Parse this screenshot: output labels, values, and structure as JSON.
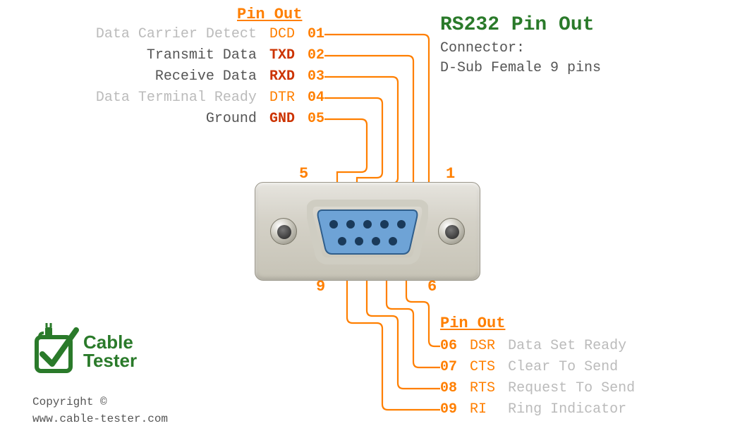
{
  "title": "RS232 Pin Out",
  "subtitle_label": "Connector:",
  "subtitle_value": "D-Sub Female 9 pins",
  "top_header": "Pin Out",
  "bot_header": "Pin Out",
  "top_pins": [
    {
      "desc": "Data Carrier Detect",
      "sig": "DCD",
      "num": "01",
      "emph": false
    },
    {
      "desc": "Transmit Data",
      "sig": "TXD",
      "num": "02",
      "emph": true
    },
    {
      "desc": "Receive  Data",
      "sig": "RXD",
      "num": "03",
      "emph": true
    },
    {
      "desc": "Data Terminal Ready",
      "sig": "DTR",
      "num": "04",
      "emph": false
    },
    {
      "desc": "Ground",
      "sig": "GND",
      "num": "05",
      "emph": true
    }
  ],
  "bot_pins": [
    {
      "num": "06",
      "sig": "DSR",
      "desc": "Data Set Ready"
    },
    {
      "num": "07",
      "sig": "CTS",
      "desc": "Clear To Send"
    },
    {
      "num": "08",
      "sig": "RTS",
      "desc": "Request To Send"
    },
    {
      "num": "09",
      "sig": "RI",
      "desc": "Ring Indicator"
    }
  ],
  "corner_labels": {
    "tl": "5",
    "tr": "1",
    "bl": "9",
    "br": "6"
  },
  "logo": {
    "line1": "Cable",
    "line2": "Tester"
  },
  "footer": {
    "copyright": "Copyright ©",
    "url": "www.cable-tester.com"
  },
  "colors": {
    "accent": "#ff7f00",
    "brand": "#2a7a2a"
  }
}
